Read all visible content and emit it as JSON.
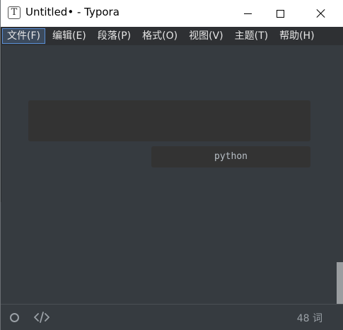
{
  "window": {
    "app_icon_letter": "T",
    "title": "Untitled• - Typora"
  },
  "menubar": {
    "items": [
      {
        "label": "文件(F)",
        "active": true
      },
      {
        "label": "编辑(E)"
      },
      {
        "label": "段落(P)"
      },
      {
        "label": "格式(O)"
      },
      {
        "label": "视图(V)"
      },
      {
        "label": "主题(T)"
      },
      {
        "label": "帮助(H)"
      }
    ]
  },
  "editor": {
    "code_block_language": "python"
  },
  "footer": {
    "word_count": "48 词",
    "icons": [
      "circle-icon",
      "source-code-icon"
    ]
  },
  "colors": {
    "editor_bg": "#363b40",
    "menubar_bg": "#2e3033",
    "code_bg": "#333333",
    "menu_active_border": "#5a8fd6"
  }
}
